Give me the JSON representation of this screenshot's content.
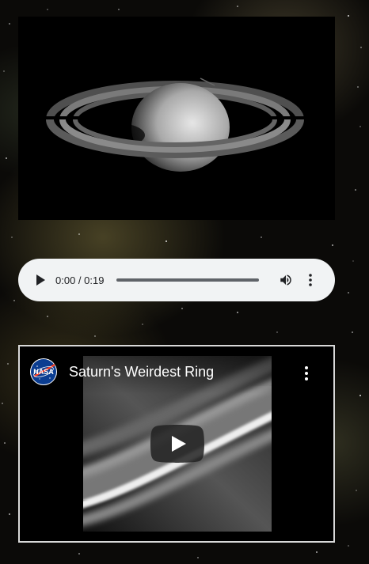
{
  "image": {
    "alt_icon": "saturn-image"
  },
  "audio": {
    "time_display": "0:00 / 0:19",
    "progress_fraction": 0,
    "icons": {
      "play": "play-icon",
      "volume": "volume-icon",
      "menu": "more-vert-icon"
    },
    "background_color": "#f1f3f4"
  },
  "video": {
    "title": "Saturn's Weirdest Ring",
    "channel_logo_text": "NASA",
    "icons": {
      "play": "youtube-play-icon",
      "menu": "more-vert-icon",
      "logo": "nasa-logo-icon"
    }
  }
}
